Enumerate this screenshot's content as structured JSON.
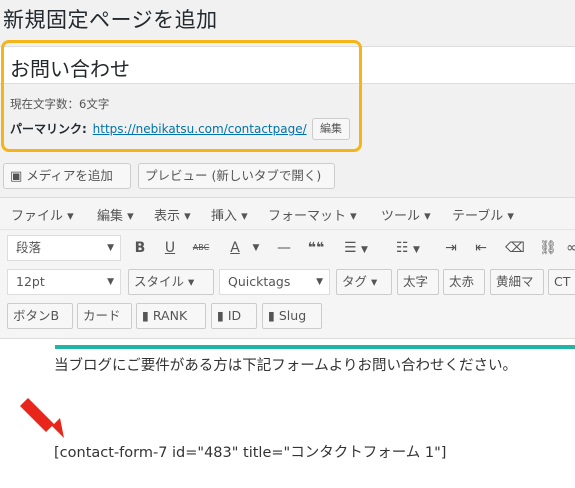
{
  "page": {
    "title": "新規固定ページを追加"
  },
  "post": {
    "title": "お問い合わせ",
    "word_count": "現在文字数：6文字",
    "permalink_label": "パーマリンク:",
    "permalink_url": "https://nebikatsu.com/contactpage/",
    "edit_label": "編集"
  },
  "media": {
    "add_media": "メディアを追加",
    "preview": "プレビュー (新しいタブで開く)"
  },
  "menubar": [
    "ファイル ▾",
    "編集 ▾",
    "表示 ▾",
    "挿入 ▾",
    "フォーマット ▾",
    "ツール ▾",
    "テーブル ▾"
  ],
  "toolbar1": {
    "format_select": "段落",
    "bold": "B",
    "underline": "U",
    "strike": "ABC",
    "textcolor": "A",
    "hr": "—",
    "quote": "❝❝"
  },
  "toolbar2": {
    "fontsize": "12pt",
    "style": "スタイル ▾",
    "quicktags": "Quicktags",
    "tag": "タグ ▾",
    "bold_btn": "太字",
    "bold_red": "太赤",
    "yellow_marker": "黄細マ",
    "ct": "CT"
  },
  "toolbar3": {
    "button_b": "ボタンB",
    "card": "カード",
    "rank": "RANK",
    "id": "ID",
    "slug": "Slug"
  },
  "content": {
    "line1": "当ブログにご要件がある方は下記フォームよりお問い合わせください。",
    "shortcode": "[contact-form-7 id=\"483\" title=\"コンタクトフォーム 1\"]"
  },
  "colors": {
    "highlight": "#f5b519",
    "teal": "#21b5a5",
    "arrow": "#e8261c",
    "link": "#0073aa"
  }
}
